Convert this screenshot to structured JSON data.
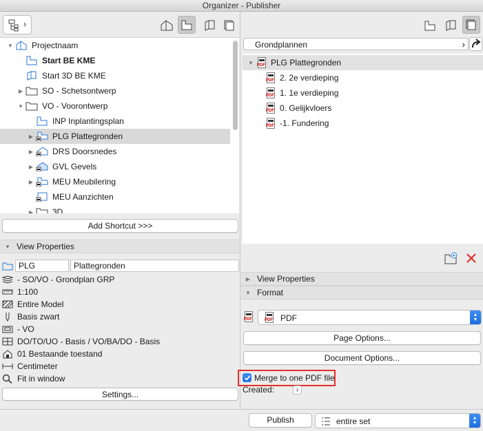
{
  "window": {
    "title": "Organizer - Publisher"
  },
  "left": {
    "tree": [
      {
        "label": "Projectnaam",
        "bold": false,
        "icon": "project-icon",
        "expander": "open",
        "indent": 0
      },
      {
        "label": "Start BE KME",
        "bold": true,
        "icon": "plan-view-icon",
        "expander": "none",
        "indent": 1
      },
      {
        "label": "Start 3D BE KME",
        "bold": false,
        "icon": "3d-view-icon",
        "expander": "none",
        "indent": 1
      },
      {
        "label": "SO - Schetsontwerp",
        "bold": false,
        "icon": "folder-icon",
        "expander": "closed",
        "indent": 1
      },
      {
        "label": "VO - Voorontwerp",
        "bold": false,
        "icon": "folder-icon",
        "expander": "open",
        "indent": 1
      },
      {
        "label": "INP Inplantingsplan",
        "bold": false,
        "icon": "plan-view-icon",
        "expander": "none",
        "indent": 2
      },
      {
        "label": "PLG Plattegronden",
        "bold": false,
        "icon": "plan-folder-icon",
        "expander": "closed",
        "indent": 2,
        "selected": true
      },
      {
        "label": "DRS Doorsnedes",
        "bold": false,
        "icon": "section-folder-icon",
        "expander": "closed",
        "indent": 2
      },
      {
        "label": "GVL Gevels",
        "bold": false,
        "icon": "elevation-folder-icon",
        "expander": "closed",
        "indent": 2
      },
      {
        "label": "MEU Meubilering",
        "bold": false,
        "icon": "plan-folder-icon",
        "expander": "closed",
        "indent": 2
      },
      {
        "label": "MEU Aanzichten",
        "bold": false,
        "icon": "interior-elevation-icon",
        "expander": "none",
        "indent": 2
      },
      {
        "label": "3D",
        "bold": false,
        "icon": "folder-icon",
        "expander": "closed",
        "indent": 2
      }
    ],
    "add_shortcut": "Add Shortcut >>>",
    "view_properties": {
      "header": "View Properties",
      "id_value": "PLG",
      "name_value": "Plattegronden",
      "rows": [
        {
          "icon": "layer-combination-icon",
          "text": "- SO/VO - Grondplan GRP"
        },
        {
          "icon": "scale-icon",
          "text": "1:100"
        },
        {
          "icon": "structure-display-icon",
          "text": "Entire Model"
        },
        {
          "icon": "pen-set-icon",
          "text": "Basis zwart"
        },
        {
          "icon": "model-view-options-icon",
          "text": "-  VO"
        },
        {
          "icon": "graphic-override-icon",
          "text": "DO/TO/UO - Basis / VO/BA/DO - Basis"
        },
        {
          "icon": "renovation-filter-icon",
          "text": "01 Bestaande toestand"
        },
        {
          "icon": "dimension-icon",
          "text": "Centimeter"
        },
        {
          "icon": "zoom-icon",
          "text": "Fit in window"
        }
      ],
      "settings_button": "Settings..."
    }
  },
  "right": {
    "path_label": "Grondplannen",
    "tree_root": "PLG Plattegronden",
    "items": [
      "2. 2e verdieping",
      "1. 1e verdieping",
      "0. Gelijkvloers",
      "-1. Fundering"
    ],
    "view_properties_header": "View Properties",
    "format_header": "Format",
    "format_value": "PDF",
    "page_options": "Page Options...",
    "document_options": "Document Options...",
    "merge_label": "Merge to one PDF file",
    "merge_checked": true,
    "created_label": "Created:",
    "highlight_color": "#e0302a"
  },
  "bottom": {
    "publish_button": "Publish",
    "publish_set": "entire set"
  },
  "colors": {
    "accent": "#1e6fe0",
    "delete_red": "#e0302a"
  }
}
